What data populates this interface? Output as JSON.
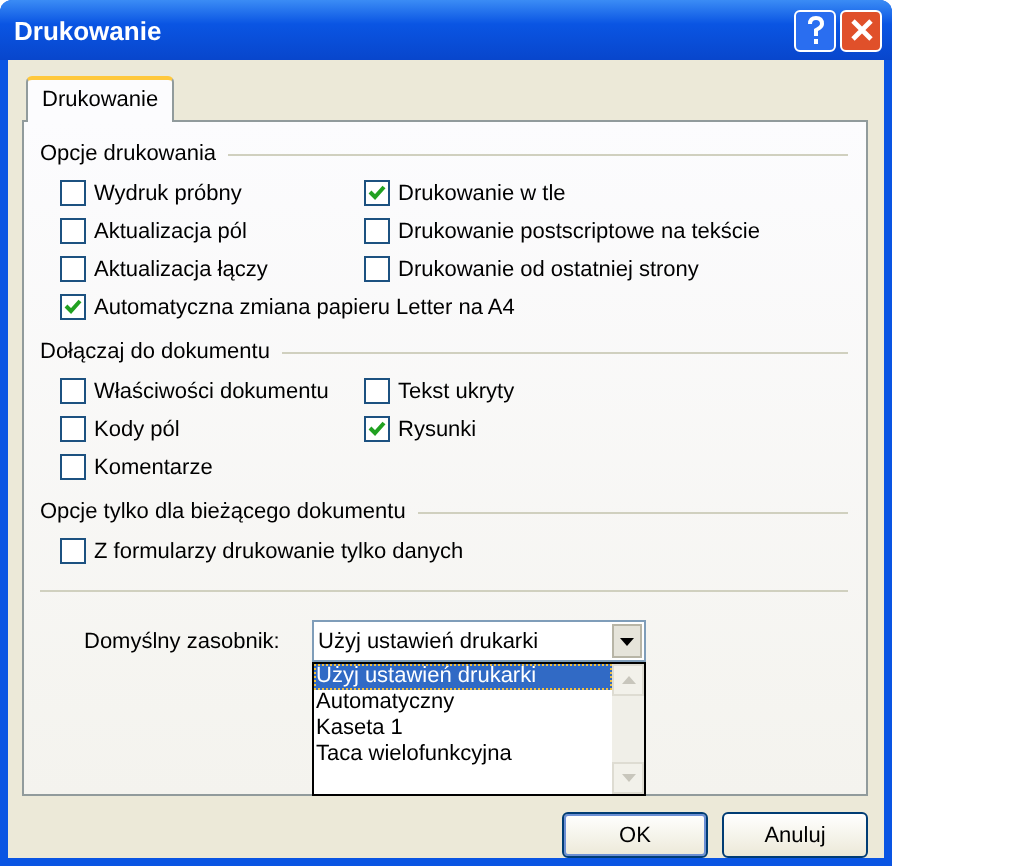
{
  "window": {
    "title": "Drukowanie"
  },
  "tabs": [
    {
      "label": "Drukowanie",
      "selected": true
    }
  ],
  "groups": [
    {
      "title": "Opcje drukowania",
      "rows": [
        [
          {
            "label": "Wydruk próbny",
            "checked": false
          },
          {
            "label": "Drukowanie w tle",
            "checked": true
          }
        ],
        [
          {
            "label": "Aktualizacja pól",
            "checked": false
          },
          {
            "label": "Drukowanie postscriptowe na tekście",
            "checked": false
          }
        ],
        [
          {
            "label": "Aktualizacja łączy",
            "checked": false
          },
          {
            "label": "Drukowanie od ostatniej strony",
            "checked": false
          }
        ],
        [
          {
            "label": "Automatyczna zmiana papieru Letter na A4",
            "checked": true
          }
        ]
      ]
    },
    {
      "title": "Dołączaj do dokumentu",
      "rows": [
        [
          {
            "label": "Właściwości dokumentu",
            "checked": false
          },
          {
            "label": "Tekst ukryty",
            "checked": false
          }
        ],
        [
          {
            "label": "Kody pól",
            "checked": false
          },
          {
            "label": "Rysunki",
            "checked": true
          }
        ],
        [
          {
            "label": "Komentarze",
            "checked": false
          }
        ]
      ]
    },
    {
      "title": "Opcje tylko dla bieżącego dokumentu",
      "rows": [
        [
          {
            "label": "Z formularzy drukowanie tylko danych",
            "checked": false
          }
        ]
      ]
    }
  ],
  "tray": {
    "label": "Domyślny zasobnik:",
    "value": "Użyj ustawień drukarki",
    "expanded": true,
    "options": [
      {
        "label": "Użyj ustawień drukarki",
        "selected": true
      },
      {
        "label": "Automatyczny",
        "selected": false
      },
      {
        "label": "Kaseta 1",
        "selected": false
      },
      {
        "label": "Taca wielofunkcyjna",
        "selected": false
      }
    ]
  },
  "buttons": [
    "OK",
    "Anuluj"
  ]
}
